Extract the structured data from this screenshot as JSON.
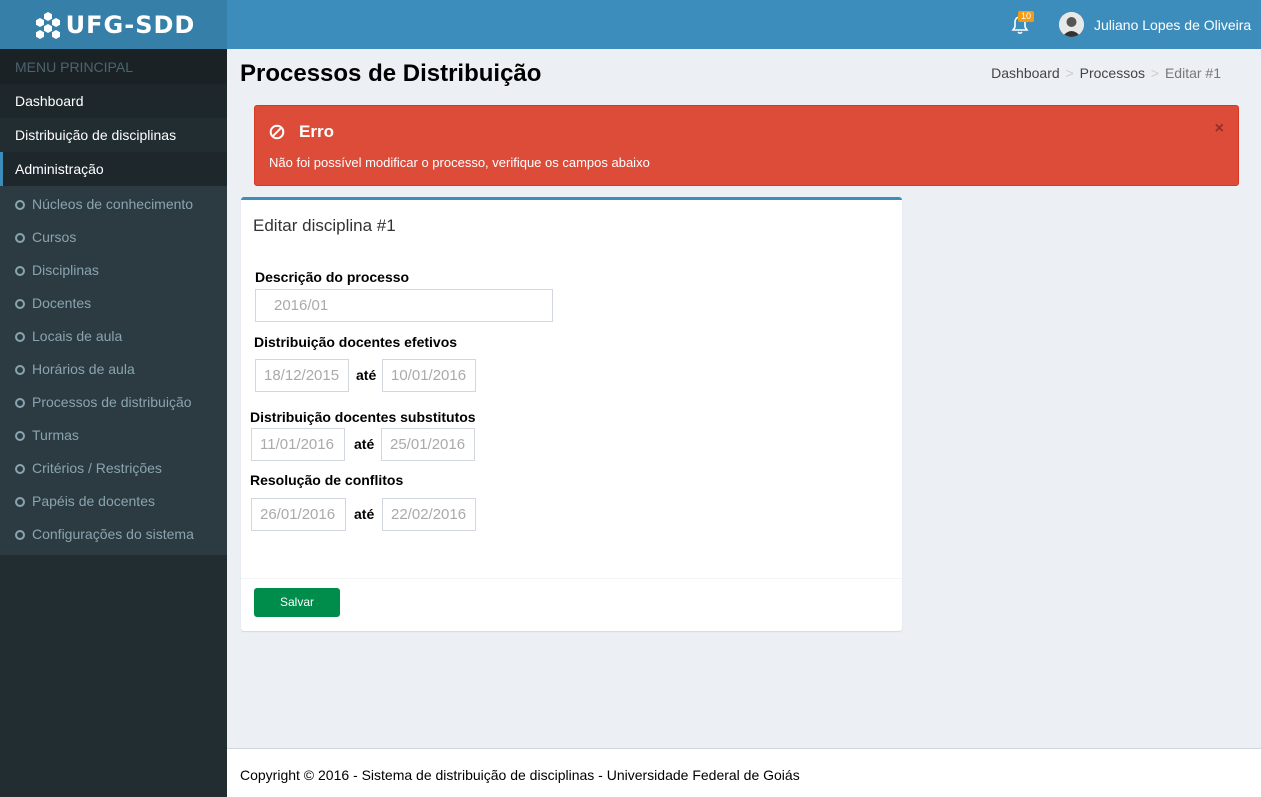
{
  "app": {
    "logo_text": "UFG-SDD"
  },
  "navbar": {
    "notification_count": "10",
    "user_name": "Juliano Lopes de Oliveira"
  },
  "sidebar": {
    "header": "MENU PRINCIPAL",
    "items": [
      {
        "label": "Dashboard"
      },
      {
        "label": "Distribuição de disciplinas"
      },
      {
        "label": "Administração"
      }
    ],
    "submenu": [
      {
        "label": "Núcleos de conhecimento"
      },
      {
        "label": "Cursos"
      },
      {
        "label": "Disciplinas"
      },
      {
        "label": "Docentes"
      },
      {
        "label": "Locais de aula"
      },
      {
        "label": "Horários de aula"
      },
      {
        "label": "Processos de distribuição"
      },
      {
        "label": "Turmas"
      },
      {
        "label": "Critérios / Restrições"
      },
      {
        "label": "Papéis de docentes"
      },
      {
        "label": "Configurações do sistema"
      }
    ]
  },
  "page": {
    "title": "Processos de Distribuição",
    "breadcrumb": [
      "Dashboard",
      "Processos",
      "Editar #1"
    ]
  },
  "alert": {
    "title": "Erro",
    "message": "Não foi possível modificar o processo, verifique os campos abaixo",
    "color": "#dd4b39"
  },
  "form": {
    "box_title": "Editar disciplina #1",
    "descricao_label": "Descrição do processo",
    "descricao_value": "2016/01",
    "efetivos_label": "Distribuição docentes efetivos",
    "efetivos_start": "18/12/2015",
    "efetivos_end": "10/01/2016",
    "substitutos_label": "Distribuição docentes substitutos",
    "substitutos_start": "11/01/2016",
    "substitutos_end": "25/01/2016",
    "conflitos_label": "Resolução de conflitos",
    "conflitos_start": "26/01/2016",
    "conflitos_end": "22/02/2016",
    "ate": "até",
    "save_label": "Salvar"
  },
  "footer": {
    "text": "Copyright © 2016 - Sistema de distribuição de disciplinas - Universidade Federal de Goiás"
  },
  "colors": {
    "navbar": "#3c8dbc",
    "logo_bg": "#367fa9",
    "sidebar": "#222d32",
    "save_button": "#008d4c"
  },
  "icons": {
    "logo": "hexagon-cluster-icon",
    "notifications": "bell-icon",
    "alert": "ban-icon",
    "close": "close-icon",
    "submenu_bullet": "circle-outline-icon"
  }
}
